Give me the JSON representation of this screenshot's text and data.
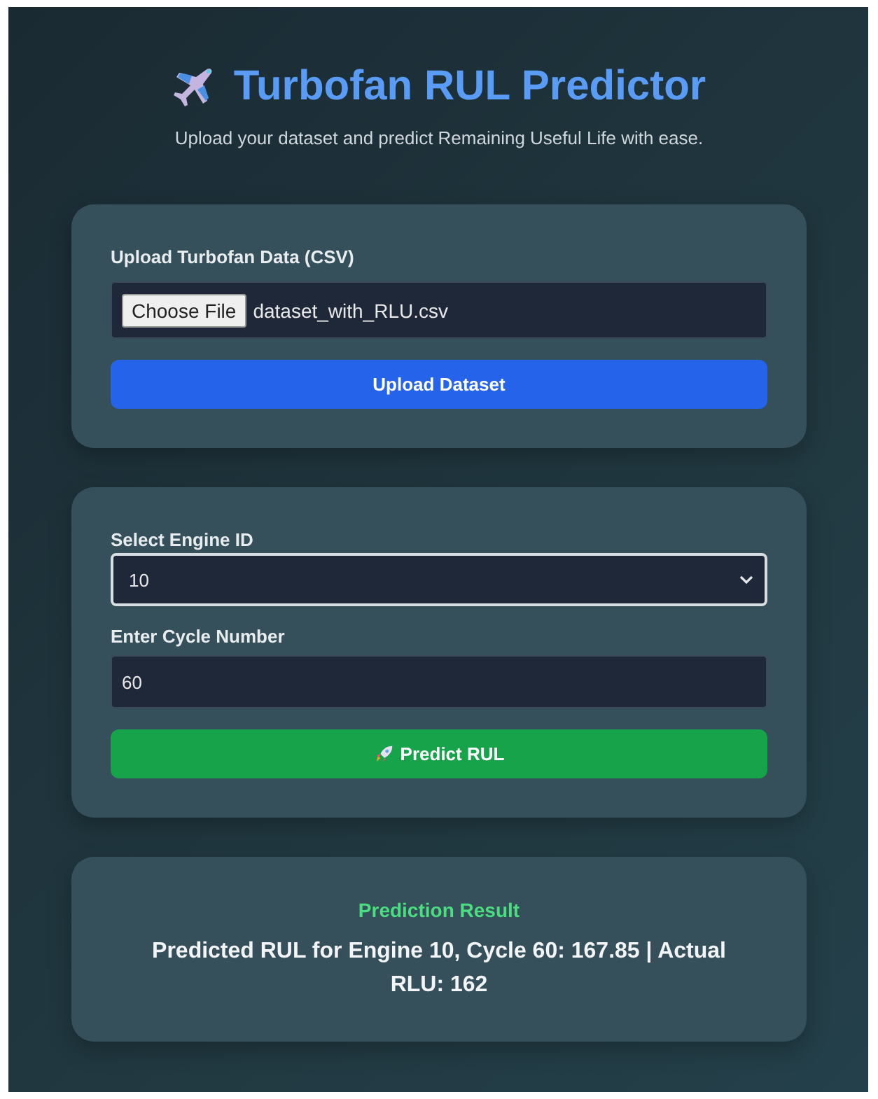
{
  "header": {
    "title": "Turbofan RUL Predictor",
    "subtitle": "Upload your dataset and predict Remaining Useful Life with ease."
  },
  "upload_card": {
    "label": "Upload Turbofan Data (CSV)",
    "file_button": "Choose File",
    "file_name": "dataset_with_RLU.csv",
    "submit": "Upload Dataset"
  },
  "predict_card": {
    "engine_label": "Select Engine ID",
    "engine_select": {
      "value": "10",
      "focused": true
    },
    "cycle_label": "Enter Cycle Number",
    "cycle_value": "60",
    "submit": "Predict RUL"
  },
  "result": {
    "title": "Prediction Result",
    "text": "Predicted RUL for Engine 10, Cycle 60: 167.85 | Actual RLU: 162"
  }
}
